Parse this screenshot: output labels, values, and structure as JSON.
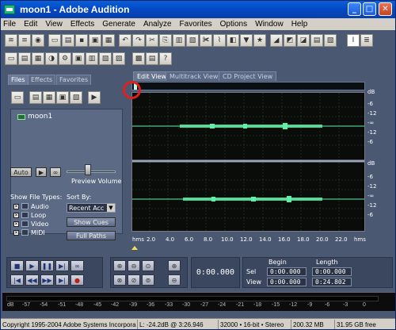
{
  "window": {
    "title": "moon1 - Adobe Audition",
    "min_symbol": "_",
    "max_symbol": "□",
    "close_symbol": "✕"
  },
  "menu": [
    "File",
    "Edit",
    "View",
    "Effects",
    "Generate",
    "Analyze",
    "Favorites",
    "Options",
    "Window",
    "Help"
  ],
  "left_panel": {
    "tabs": [
      "Files",
      "Effects",
      "Favorites"
    ],
    "files": [
      {
        "name": "moon1"
      }
    ],
    "auto_button": "Auto",
    "preview_volume_label": "Preview Volume",
    "show_file_types_label": "Show File Types:",
    "file_types": [
      {
        "label": "Audio",
        "checked": true
      },
      {
        "label": "Loop",
        "checked": true
      },
      {
        "label": "Video",
        "checked": true
      },
      {
        "label": "MIDI",
        "checked": true
      }
    ],
    "sort_by_label": "Sort By:",
    "sort_by_value": "Recent Acc",
    "show_cues_button": "Show Cues",
    "full_paths_button": "Full Paths"
  },
  "editor": {
    "tabs": [
      "Edit View",
      "Multitrack View",
      "CD Project View"
    ],
    "db_scale_top": [
      "dB",
      "-6",
      "-12",
      "-∞",
      "-12",
      "-6"
    ],
    "db_scale_bottom": [
      "dB",
      "-6",
      "-12",
      "-∞",
      "-12",
      "-6"
    ],
    "ruler_labels": [
      "hms",
      "2.0",
      "4.0",
      "6.0",
      "8.0",
      "10.0",
      "12.0",
      "14.0",
      "16.0",
      "18.0",
      "20.0",
      "22.0",
      "hms"
    ]
  },
  "transport": {
    "time_display": "0:00.000",
    "begin_header": "Begin",
    "length_header": "Length",
    "sel_label": "Sel",
    "view_label": "View",
    "sel_begin": "0:00.000",
    "sel_length": "0:00.000",
    "view_begin": "0:00.000",
    "view_length": "0:24.802"
  },
  "level_meter": {
    "labels": [
      "dB",
      "-57",
      "-54",
      "-51",
      "-48",
      "-45",
      "-42",
      "-39",
      "-36",
      "-33",
      "-30",
      "-27",
      "-24",
      "-21",
      "-18",
      "-15",
      "-12",
      "-9",
      "-6",
      "-3",
      "0"
    ]
  },
  "status_bar": {
    "copyright": "Copyright 1995-2004 Adobe Systems Incorpora",
    "cursor": "L: -24.2dB @  3:26.946",
    "format": "32000 • 16-bit • Stereo",
    "size": "200.32 MB",
    "free": "31.95 GB free"
  },
  "colors": {
    "waveform": "#5ef0a8",
    "accent_ring": "#e0201c",
    "panel_bg": "#4a5872"
  }
}
